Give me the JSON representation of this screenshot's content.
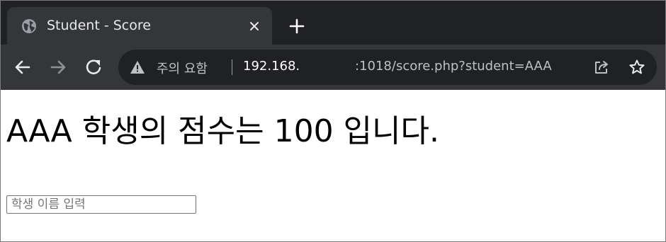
{
  "browser": {
    "tab": {
      "title": "Student - Score"
    },
    "address_bar": {
      "warning_text": "주의 요함",
      "url_host": "192.168.",
      "url_path": ":1018/score.php?student=AAA"
    }
  },
  "page": {
    "headline": "AAA 학생의 점수는 100 입니다.",
    "student_input": {
      "value": "",
      "placeholder": "학생 이름 입력"
    }
  },
  "icons": {
    "tab_favicon": "globe-icon",
    "tab_close": "close-icon",
    "new_tab": "plus-icon",
    "back": "back-arrow-icon",
    "forward": "forward-arrow-icon",
    "reload": "reload-icon",
    "warning": "warning-icon",
    "share": "share-icon",
    "bookmark": "star-icon"
  },
  "colors": {
    "tabstrip_bg": "#202124",
    "toolbar_bg": "#35363a",
    "omnibox_bg": "#202124",
    "text_light": "#e8eaed",
    "text_muted": "#bdc1c6"
  }
}
